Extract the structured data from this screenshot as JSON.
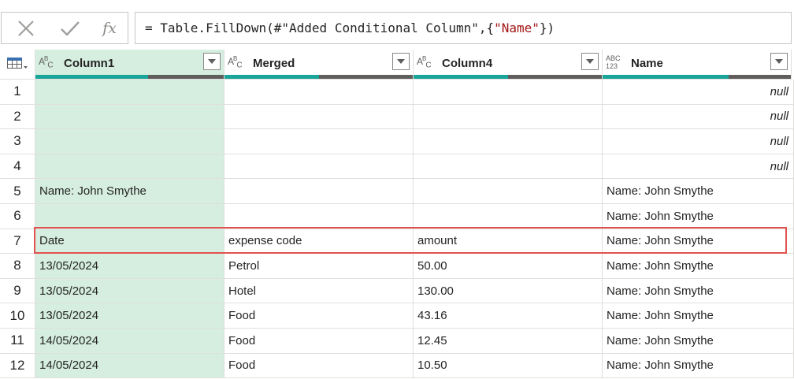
{
  "formula_bar": {
    "cancel_icon": "x-icon",
    "commit_icon": "checkmark-icon",
    "fx_label": "fx",
    "formula_prefix": "= Table.FillDown(#\"Added Conditional Column\",{",
    "formula_string": "\"Name\"",
    "formula_suffix": "})"
  },
  "table": {
    "corner_icon": "table-menu-icon",
    "columns": [
      {
        "type": "ABC",
        "title": "Column1",
        "valid_fraction": 0.6,
        "selected": true
      },
      {
        "type": "ABC",
        "title": "Merged",
        "valid_fraction": 0.5,
        "selected": false
      },
      {
        "type": "ABC",
        "title": "Column4",
        "valid_fraction": 0.5,
        "selected": false
      },
      {
        "type": "ABC123",
        "title": "Name",
        "valid_fraction": 0.67,
        "selected": false
      }
    ],
    "rows": [
      {
        "n": "1",
        "c1": "",
        "merged": "",
        "c4": "",
        "name": "null"
      },
      {
        "n": "2",
        "c1": "",
        "merged": "",
        "c4": "",
        "name": "null"
      },
      {
        "n": "3",
        "c1": "",
        "merged": "",
        "c4": "",
        "name": "null"
      },
      {
        "n": "4",
        "c1": "",
        "merged": "",
        "c4": "",
        "name": "null"
      },
      {
        "n": "5",
        "c1": "Name: John Smythe",
        "merged": "",
        "c4": "",
        "name": "Name: John Smythe"
      },
      {
        "n": "6",
        "c1": "",
        "merged": "",
        "c4": "",
        "name": "Name: John Smythe"
      },
      {
        "n": "7",
        "c1": "Date",
        "merged": "expense code",
        "c4": "amount",
        "name": "Name: John Smythe"
      },
      {
        "n": "8",
        "c1": "13/05/2024",
        "merged": "Petrol",
        "c4": "50.00",
        "name": "Name: John Smythe"
      },
      {
        "n": "9",
        "c1": "13/05/2024",
        "merged": "Hotel",
        "c4": "130.00",
        "name": "Name: John Smythe"
      },
      {
        "n": "10",
        "c1": "13/05/2024",
        "merged": "Food",
        "c4": "43.16",
        "name": "Name: John Smythe"
      },
      {
        "n": "11",
        "c1": "14/05/2024",
        "merged": "Food",
        "c4": "12.45",
        "name": "Name: John Smythe"
      },
      {
        "n": "12",
        "c1": "14/05/2024",
        "merged": "Food",
        "c4": "10.50",
        "name": "Name: John Smythe"
      }
    ],
    "highlighted_row": "7"
  },
  "colors": {
    "selected_column": "#d5eee0",
    "valid_bar": "#1aa59a",
    "empty_bar": "#605e5c",
    "highlight": "#e0524d",
    "string_literal": "#a31515"
  }
}
